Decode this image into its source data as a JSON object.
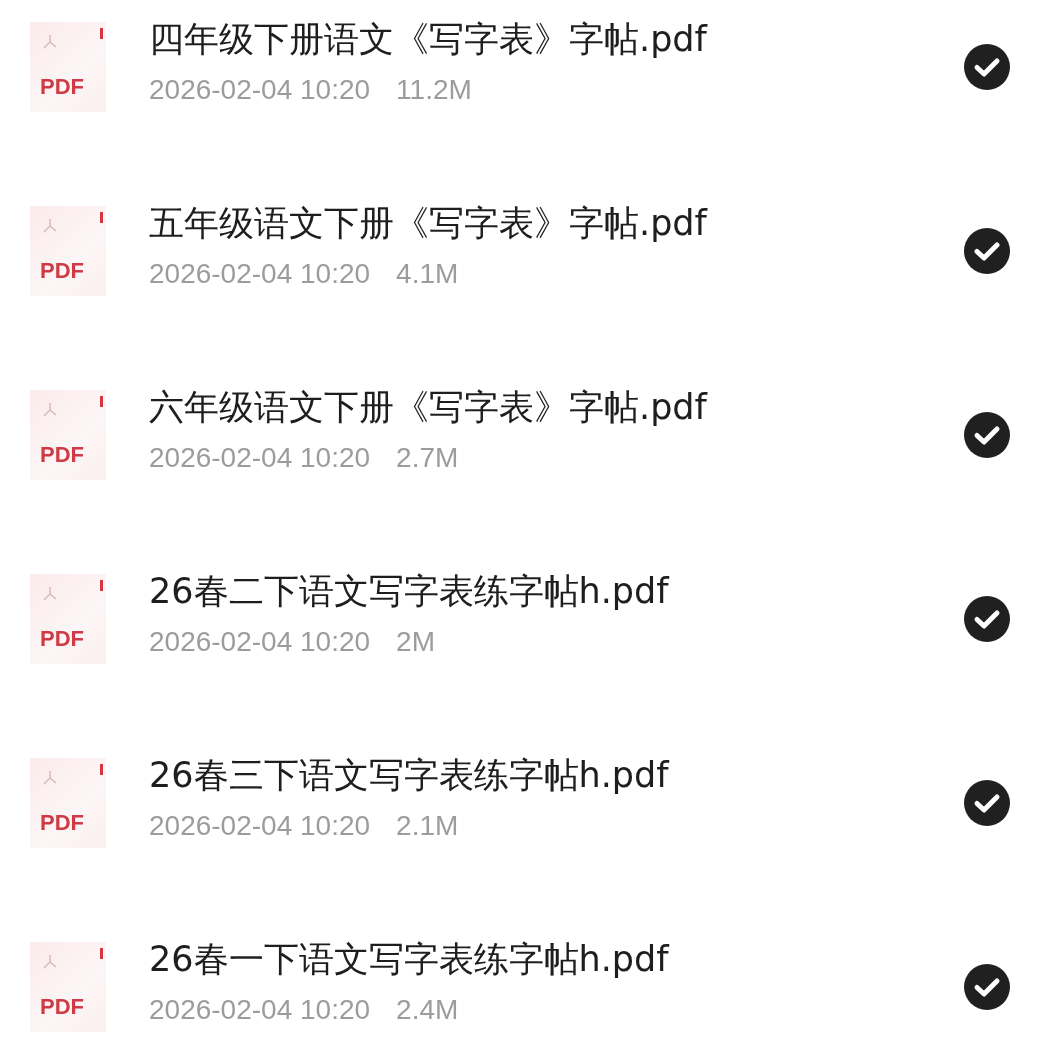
{
  "files": [
    {
      "type_label": "PDF",
      "name": "四年级下册语文《写字表》字帖.pdf",
      "date": "2026-02-04 10:20",
      "size": "11.2M",
      "selected": true
    },
    {
      "type_label": "PDF",
      "name": "五年级语文下册《写字表》字帖.pdf",
      "date": "2026-02-04 10:20",
      "size": "4.1M",
      "selected": true
    },
    {
      "type_label": "PDF",
      "name": "六年级语文下册《写字表》字帖.pdf",
      "date": "2026-02-04 10:20",
      "size": "2.7M",
      "selected": true
    },
    {
      "type_label": "PDF",
      "name": "26春二下语文写字表练字帖h.pdf",
      "date": "2026-02-04 10:20",
      "size": "2M",
      "selected": true
    },
    {
      "type_label": "PDF",
      "name": "26春三下语文写字表练字帖h.pdf",
      "date": "2026-02-04 10:20",
      "size": "2.1M",
      "selected": true
    },
    {
      "type_label": "PDF",
      "name": "26春一下语文写字表练字帖h.pdf",
      "date": "2026-02-04 10:20",
      "size": "2.4M",
      "selected": true
    }
  ]
}
